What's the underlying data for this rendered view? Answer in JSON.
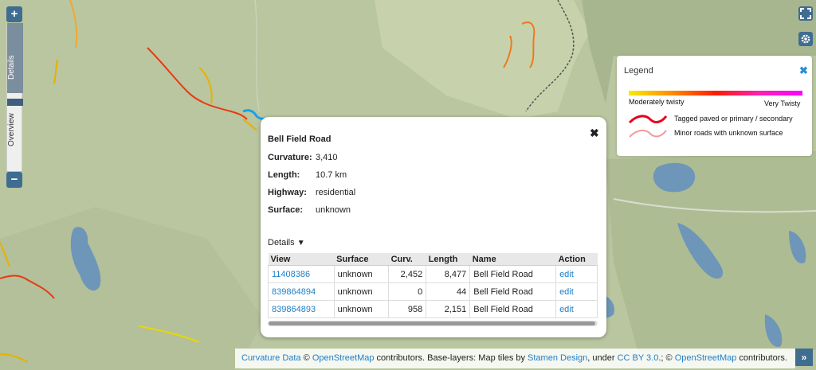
{
  "zoom": {
    "plus_label": "+",
    "minus_label": "−",
    "details_label": "Details",
    "overview_label": "Overview"
  },
  "map_controls": {
    "fullscreen_icon": "fullscreen-icon",
    "settings_icon": "gear-icon"
  },
  "legend": {
    "title": "Legend",
    "close_icon": "close-icon",
    "low_label": "Moderately twisty",
    "high_label": "Very Twisty",
    "paved_label": "Tagged paved or primary / secondary",
    "unknown_label": "Minor roads with unknown surface",
    "paved_color": "#e8001b",
    "unknown_color": "#f39a9a"
  },
  "popup": {
    "road_name": "Bell Field Road",
    "close_label": "✖",
    "fields": [
      {
        "key": "Curvature:",
        "value": "3,410"
      },
      {
        "key": "Length:",
        "value": "10.7 km"
      },
      {
        "key": "Highway:",
        "value": "residential"
      },
      {
        "key": "Surface:",
        "value": "unknown"
      }
    ],
    "details_label": "Details",
    "details_arrow": "▼",
    "table": {
      "headers": [
        "View",
        "Surface",
        "Curv.",
        "Length",
        "Name",
        "Action"
      ],
      "rows": [
        [
          "11408386",
          "unknown",
          "2,452",
          "8,477",
          "Bell Field Road",
          "edit"
        ],
        [
          "839864894",
          "unknown",
          "0",
          "44",
          "Bell Field Road",
          "edit"
        ],
        [
          "839864893",
          "unknown",
          "958",
          "2,151",
          "Bell Field Road",
          "edit"
        ]
      ]
    }
  },
  "attribution": {
    "curvature_link": "Curvature Data",
    "copy1": " © ",
    "osm_link1": "OpenStreetMap",
    "text1": " contributors. Base-layers: Map tiles by ",
    "stamen_link": "Stamen Design",
    "text2": ", under ",
    "license_link": "CC BY 3.0",
    "text3": ".; © ",
    "osm_link2": "OpenStreetMap",
    "text4": " contributors.",
    "toggle_label": "»"
  },
  "colors": {
    "land": "#b9c6a0",
    "water": "#6e96b8",
    "highlight_road": "#1aa0e8",
    "control_blue": "#3f6d8f"
  }
}
